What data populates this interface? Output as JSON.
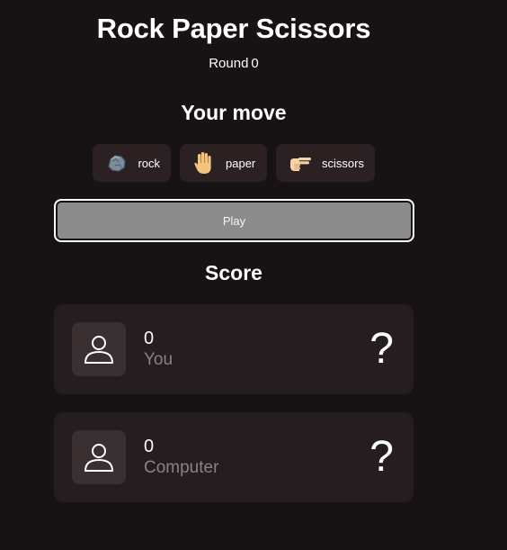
{
  "title": "Rock Paper Scissors",
  "round": {
    "label": "Round",
    "number": "0"
  },
  "your_move_heading": "Your move",
  "moves": [
    {
      "label": "rock",
      "icon": "rock-icon"
    },
    {
      "label": "paper",
      "icon": "raised-hand-icon"
    },
    {
      "label": "scissors",
      "icon": "victory-hand-icon"
    }
  ],
  "play_label": "Play",
  "score_heading": "Score",
  "players": [
    {
      "name": "You",
      "score": "0",
      "choice": "?",
      "icon": "user-icon"
    },
    {
      "name": "Computer",
      "score": "0",
      "choice": "?",
      "icon": "user-icon"
    }
  ],
  "colors": {
    "background": "#171213",
    "card": "#251d1f",
    "button": "#2b2123",
    "play_button": "#8c8c8c",
    "muted_text": "#8a8385"
  }
}
